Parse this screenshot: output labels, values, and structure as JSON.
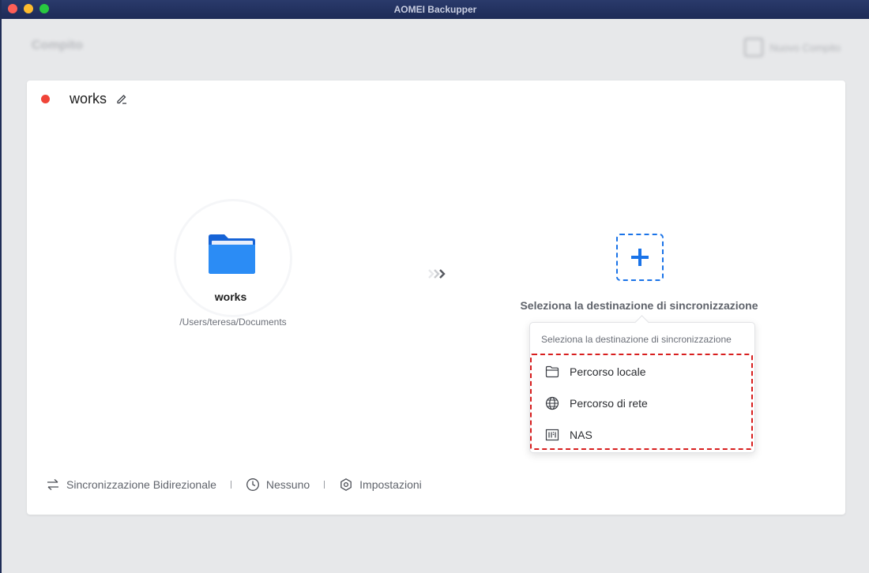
{
  "window": {
    "title": "AOMEI Backupper"
  },
  "background_header": {
    "title": "Compito",
    "right_action": "Nuovo Compito"
  },
  "task": {
    "name": "works"
  },
  "source": {
    "name": "works",
    "path": "/Users/teresa/Documents"
  },
  "destination": {
    "label": "Seleziona la destinazione di sincronizzazione",
    "popover_title": "Seleziona la destinazione di sincronizzazione",
    "options": [
      {
        "label": "Percorso locale",
        "icon": "folder-icon"
      },
      {
        "label": "Percorso di rete",
        "icon": "globe-icon"
      },
      {
        "label": "NAS",
        "icon": "nas-icon"
      }
    ]
  },
  "footer": {
    "sync_mode": "Sincronizzazione Bidirezionale",
    "schedule": "Nessuno",
    "settings": "Impostazioni"
  },
  "colors": {
    "accent": "#1a73e8",
    "status_dot": "#f04438",
    "highlight": "#d81e1e",
    "folder": "#1a73e8"
  }
}
